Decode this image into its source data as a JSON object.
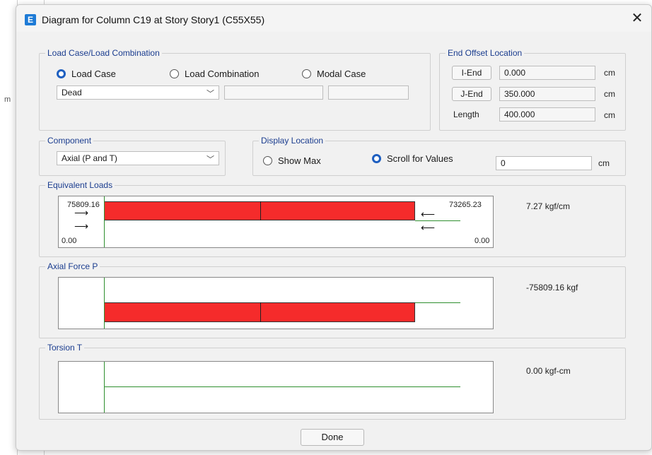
{
  "window": {
    "title": "Diagram for Column C19 at Story Story1 (C55X55)",
    "app_icon": "E"
  },
  "load_case": {
    "label": "Load Case/Load Combination",
    "options": [
      "Load Case",
      "Load Combination",
      "Modal Case"
    ],
    "selected": "Dead"
  },
  "end_offset": {
    "label": "End Offset Location",
    "i_end_label": "I-End",
    "i_end_value": "0.000",
    "j_end_label": "J-End",
    "j_end_value": "350.000",
    "length_label": "Length",
    "length_value": "400.000",
    "unit": "cm"
  },
  "component": {
    "label": "Component",
    "selected": "Axial (P and T)"
  },
  "display_location": {
    "label": "Display Location",
    "show_max": "Show Max",
    "scroll": "Scroll for Values",
    "value": "0",
    "unit": "cm"
  },
  "equivalent_loads": {
    "label": "Equivalent Loads",
    "left_top": "75809.16",
    "right_top": "73265.23",
    "left_bottom": "0.00",
    "right_bottom": "0.00",
    "side": "7.27 kgf/cm"
  },
  "axial_force": {
    "label": "Axial Force P",
    "side": "-75809.16 kgf"
  },
  "torsion": {
    "label": "Torsion T",
    "side": "0.00 kgf-cm"
  },
  "buttons": {
    "done": "Done"
  },
  "colors": {
    "bar": "#f52b2b",
    "axis": "#2f8f2f",
    "accent": "#1e5fc0"
  },
  "icons": [
    "close-icon",
    "chevron-down-icon",
    "right-arrow-icon",
    "left-arrow-icon",
    "double-right-arrow-icon",
    "double-left-arrow-icon"
  ]
}
